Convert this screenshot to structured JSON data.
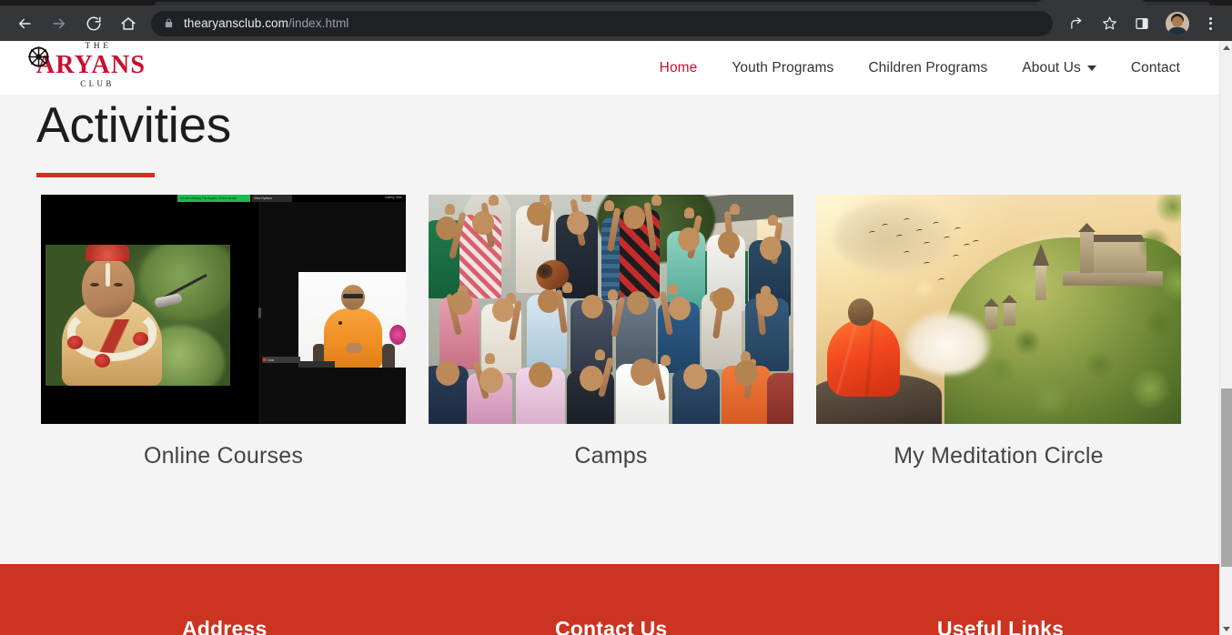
{
  "browser": {
    "url_domain": "thearyansclub.com",
    "url_path": "/index.html",
    "back_icon": "back-arrow-icon",
    "forward_icon": "forward-arrow-icon",
    "reload_icon": "reload-icon",
    "home_icon": "home-icon",
    "lock_icon": "lock-icon",
    "share_icon": "share-icon",
    "bookmark_icon": "star-icon",
    "side_panel_icon": "side-panel-icon",
    "profile_icon": "profile-avatar",
    "menu_icon": "three-dot-menu-icon"
  },
  "site": {
    "logo": {
      "line1": "THE",
      "line2": "ARYANS",
      "line3": "CLUB",
      "emblem": "chakra-icon",
      "accent_color": "#c8102e"
    },
    "nav": [
      {
        "label": "Home",
        "active": true,
        "has_dropdown": false
      },
      {
        "label": "Youth Programs",
        "active": false,
        "has_dropdown": false
      },
      {
        "label": "Children Programs",
        "active": false,
        "has_dropdown": false
      },
      {
        "label": "About Us",
        "active": false,
        "has_dropdown": true
      },
      {
        "label": "Contact",
        "active": false,
        "has_dropdown": false
      }
    ]
  },
  "main": {
    "heading": "Activities",
    "accent_color": "#cc3320",
    "cards": [
      {
        "caption": "Online Courses",
        "image": "zoom-online-class-screenshot",
        "overlay": {
          "banner": "You are viewing The Aryans Club's screen",
          "view_options": "View Options",
          "gallery": "Gallery View",
          "chat": "Chat"
        }
      },
      {
        "caption": "Camps",
        "image": "youth-camp-group-photo"
      },
      {
        "caption": "My Meditation Circle",
        "image": "monk-meditating-landscape"
      }
    ]
  },
  "footer": {
    "background_color": "#cc3320",
    "columns": [
      {
        "title": "Address"
      },
      {
        "title": "Contact Us"
      },
      {
        "title": "Useful Links"
      }
    ]
  }
}
